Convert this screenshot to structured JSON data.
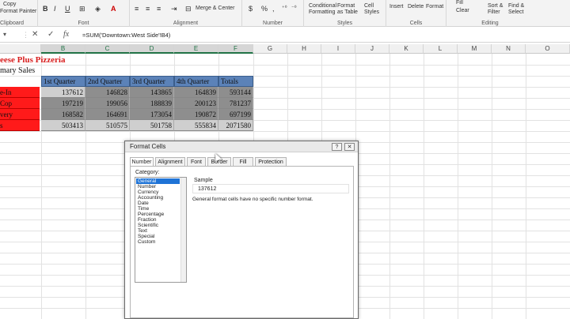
{
  "ribbon": {
    "clipboard": {
      "copy": "Copy",
      "format_painter": "Format Painter",
      "group": "Clipboard"
    },
    "font": {
      "bold": "B",
      "italic": "I",
      "underline": "U",
      "group": "Font"
    },
    "alignment": {
      "merge_center": "Merge & Center",
      "group": "Alignment"
    },
    "number": {
      "currency": "$",
      "percent": "%",
      "comma": ",",
      "group": "Number"
    },
    "styles": {
      "conditional_formatting": "Conditional Formatting",
      "format_as_table": "Format as Table",
      "cell_styles": "Cell Styles",
      "group": "Styles"
    },
    "cells": {
      "insert": "Insert",
      "delete": "Delete",
      "format": "Format",
      "group": "Cells"
    },
    "editing": {
      "fill": "Fill",
      "clear": "Clear",
      "sort_filter": "Sort & Filter",
      "find_select": "Find & Select",
      "group": "Editing"
    }
  },
  "formula_bar": {
    "formula": "=SUM('Downtown:West Side'!B4)",
    "cancel_icon": "✕",
    "enter_icon": "✓",
    "fx_icon": "fx"
  },
  "sheet": {
    "columns": [
      "B",
      "C",
      "D",
      "E",
      "F",
      "G",
      "H",
      "I",
      "J",
      "K",
      "L",
      "M",
      "N",
      "O"
    ],
    "title": "eese Plus Pizzeria",
    "subtitle": "mary Sales",
    "headers": [
      "1st Quarter",
      "2nd Quarter",
      "3rd Quarter",
      "4th Quarter",
      "Totals"
    ],
    "rows": [
      {
        "label": "e-In",
        "values": [
          "137612",
          "146828",
          "143865",
          "164839",
          "593144"
        ]
      },
      {
        "label": "Cop",
        "values": [
          "197219",
          "199056",
          "188839",
          "200123",
          "781237"
        ]
      },
      {
        "label": "very",
        "values": [
          "168582",
          "164691",
          "173054",
          "190872",
          "697199"
        ]
      },
      {
        "label": "s",
        "values": [
          "503413",
          "510575",
          "501758",
          "555834",
          "2071580"
        ]
      }
    ]
  },
  "dialog": {
    "title": "Format Cells",
    "help": "?",
    "close": "✕",
    "tabs": [
      "Number",
      "Alignment",
      "Font",
      "Border",
      "Fill",
      "Protection"
    ],
    "active_tab": "Number",
    "category_label": "Category:",
    "categories": [
      "General",
      "Number",
      "Currency",
      "Accounting",
      "Date",
      "Time",
      "Percentage",
      "Fraction",
      "Scientific",
      "Text",
      "Special",
      "Custom"
    ],
    "selected_category": "General",
    "sample_label": "Sample",
    "sample_value": "137612",
    "format_note": "General format cells have no specific number format."
  }
}
